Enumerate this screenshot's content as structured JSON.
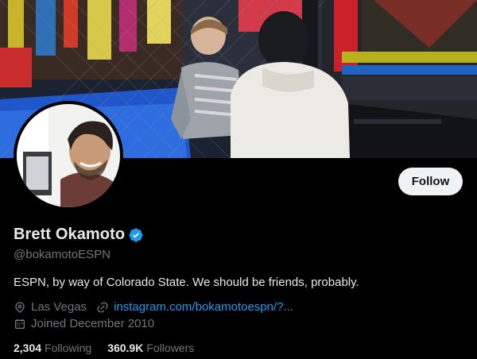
{
  "profile": {
    "display_name": "Brett Okamoto",
    "handle": "@bokamotoESPN",
    "bio": "ESPN, by way of Colorado State. We should be friends, probably.",
    "location": "Las Vegas",
    "website": "instagram.com/bokamotoespn/?...",
    "joined": "Joined December 2010",
    "verified": true
  },
  "actions": {
    "follow_label": "Follow"
  },
  "stats": {
    "following_count": "2,304",
    "following_label": "Following",
    "followers_count": "360.9K",
    "followers_label": "Followers"
  },
  "colors": {
    "background": "#000000",
    "text_primary": "#e7e9ea",
    "text_secondary": "#71767b",
    "link": "#1d9bf0",
    "follow_button_bg": "#eff3f4",
    "verified_badge": "#1d9bf0"
  },
  "icons": {
    "verified": "verified-badge-icon",
    "location": "location-pin-icon",
    "link": "link-icon",
    "calendar": "calendar-icon"
  }
}
